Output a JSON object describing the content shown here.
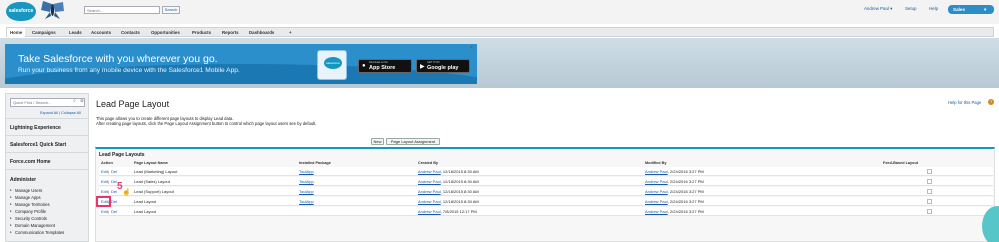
{
  "header": {
    "logo_text": "salesforce",
    "search_placeholder": "Search...",
    "search_button": "Search",
    "user_menu": "Andrew Paul ▾",
    "setup": "Setup",
    "help": "Help",
    "app_menu": "Sales",
    "brand_color": "#1797c0"
  },
  "tabs": [
    {
      "label": "Home"
    },
    {
      "label": "Campaigns"
    },
    {
      "label": "Leads"
    },
    {
      "label": "Accounts"
    },
    {
      "label": "Contacts"
    },
    {
      "label": "Opportunities"
    },
    {
      "label": "Products"
    },
    {
      "label": "Reports"
    },
    {
      "label": "Dashboards"
    },
    {
      "label": "+"
    }
  ],
  "banner": {
    "headline": "Take Salesforce with you wherever you go.",
    "subline": "Run your business from any mobile device with the Salesforce1 Mobile App.",
    "phone_logo": "salesforce",
    "appstore_small": "Download on the",
    "appstore_big": "App Store",
    "googleplay_small": "GET IT ON",
    "googleplay_big": "Google play",
    "close": "×"
  },
  "sidebar": {
    "quick_find_placeholder": "Quick Find / Search...",
    "expand_collapse": "Expand All | Collapse All",
    "sections": [
      {
        "label": "Lightning Experience"
      },
      {
        "label": "Salesforce1 Quick Start"
      },
      {
        "label": "Force.com Home"
      },
      {
        "label": "Administer"
      }
    ],
    "items": [
      {
        "label": "Manage Users"
      },
      {
        "label": "Manage Apps"
      },
      {
        "label": "Manage Territories"
      },
      {
        "label": "Company Profile"
      },
      {
        "label": "Security Controls"
      },
      {
        "label": "Domain Management"
      },
      {
        "label": "Communication Templates"
      }
    ]
  },
  "main": {
    "title": "Lead Page Layout",
    "help_link": "Help for this Page",
    "help_icon": "?",
    "desc_line1": "This page allows you to create different page layouts to display Lead data.",
    "desc_line2": "After creating page layouts, click the Page Layout Assignment button to control which page layout users see by default.",
    "new_button": "New",
    "assignment_button": "Page Layout Assignment"
  },
  "table": {
    "title": "Lead Page Layouts",
    "columns": [
      "Action",
      "Page Layout Name",
      "Installed Package",
      "Created By",
      "Modified By",
      "Feed-Based Layout"
    ],
    "edit_label": "Edit",
    "del_label": "Del",
    "rows": [
      {
        "name": "Lead (Marketing) Layout",
        "package": "ToutApp",
        "created": "Andrew Paul, 12/18/2015 8:30 AM",
        "created_by": "Andrew Paul",
        "created_date": ", 12/18/2015 8:30 AM",
        "modified_by": "Andrew Paul",
        "modified_date": ", 2/24/2016 3:27 PM"
      },
      {
        "name": "Lead (Sales) Layout",
        "package": "ToutApp",
        "created_by": "Andrew Paul",
        "created_date": ", 12/18/2015 8:30 AM",
        "modified_by": "Andrew Paul",
        "modified_date": ", 2/24/2016 3:27 PM"
      },
      {
        "name": "Lead (Support) Layout",
        "package": "ToutApp",
        "created_by": "Andrew Paul",
        "created_date": ", 12/18/2015 8:30 AM",
        "modified_by": "Andrew Paul",
        "modified_date": ", 2/24/2016 3:27 PM"
      },
      {
        "name": "Lead Layout",
        "package": "ToutApp",
        "created_by": "Andrew Paul",
        "created_date": ", 12/18/2015 8:30 AM",
        "modified_by": "Andrew Paul",
        "modified_date": ", 2/24/2016 3:27 PM"
      },
      {
        "name": "Lead Layout",
        "package": "",
        "created_by": "Andrew Paul",
        "created_date": ", 7/8/2015 12:17 PM",
        "modified_by": "Andrew Paul",
        "modified_date": ", 2/24/2016 3:27 PM"
      }
    ]
  },
  "annotation": {
    "step": "5",
    "highlight_color": "#e8356c"
  }
}
